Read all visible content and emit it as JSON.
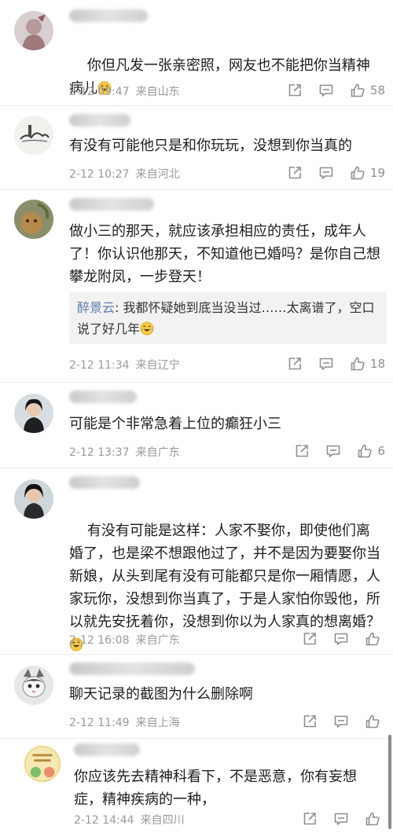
{
  "comments": [
    {
      "text": "你但凡发一张亲密照，网友也不能把你当精神病儿",
      "date": "2-12 09:47",
      "location": "来自山东",
      "likes": "58"
    },
    {
      "text": "有没有可能他只是和你玩玩，没想到你当真的",
      "date": "2-12 10:27",
      "location": "来自河北",
      "likes": "19"
    },
    {
      "text": "做小三的那天，就应该承担相应的责任，成年人了！你认识他那天，不知道他已婚吗？是你自己想攀龙附凤，一步登天！",
      "reply_name": "醉景云",
      "reply_text": ": 我都怀疑她到底当没当过……太离谱了，空口说了好几年",
      "date": "2-12 11:34",
      "location": "来自辽宁",
      "likes": "18"
    },
    {
      "text": "可能是个非常急着上位的癫狂小三",
      "date": "2-12 13:37",
      "location": "来自广东",
      "likes": "6"
    },
    {
      "text": "有没有可能是这样：人家不娶你，即使他们离婚了，也是梁不想跟他过了，并不是因为要娶你当新娘，从头到尾有没有可能都只是你一厢情愿，人家玩你，没想到你当真了，于是人家怕你毁他，所以就先安抚着你，没想到你以为人家真的想离婚？",
      "date": "2-12 16:08",
      "location": "来自广东",
      "likes": ""
    },
    {
      "text": "聊天记录的截图为什么删除啊",
      "date": "2-12 11:49",
      "location": "来自上海",
      "likes": ""
    },
    {
      "text": "你应该先去精神科看下，不是恶意，你有妄想症，精神疾病的一种，",
      "date": "2-12 14:44",
      "location": "来自四川",
      "likes": ""
    }
  ],
  "colors": {
    "reply_name": "#5b7eaf",
    "meta": "#9a9a9a",
    "icon": "#8f8f8f"
  },
  "icons": [
    "share-icon",
    "comment-icon",
    "like-icon",
    "laugh-cry-emoji"
  ]
}
